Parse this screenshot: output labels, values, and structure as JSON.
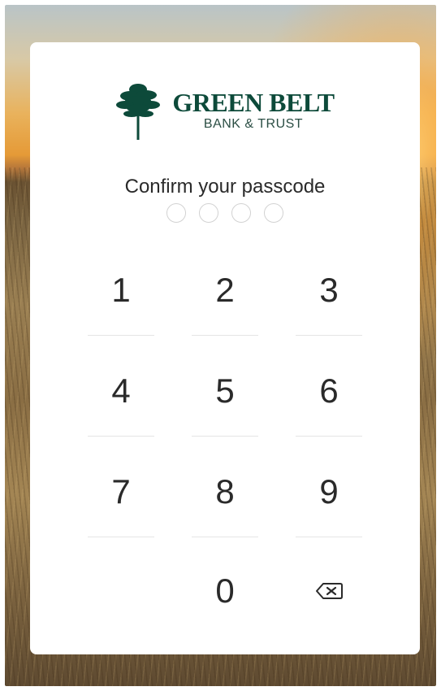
{
  "brand": {
    "name": "GREEN BELT",
    "subtitle": "BANK & TRUST",
    "color": "#0d4a3a"
  },
  "prompt": "Confirm your passcode",
  "passcode": {
    "length": 4,
    "entered": 0
  },
  "keypad": {
    "keys": [
      "1",
      "2",
      "3",
      "4",
      "5",
      "6",
      "7",
      "8",
      "9",
      "0"
    ],
    "delete_icon": "backspace-icon"
  }
}
